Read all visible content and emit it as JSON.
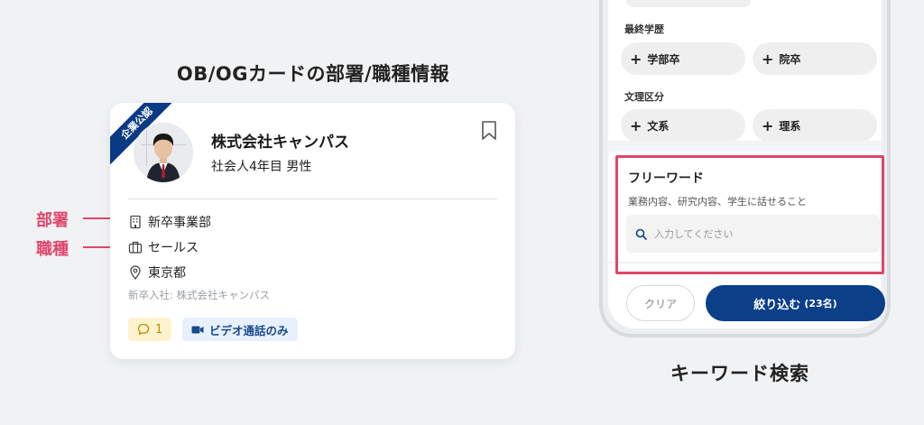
{
  "left": {
    "title": "OB/OGカードの部署/職種情報",
    "ribbon": "企業公認",
    "company": "株式会社キャンパス",
    "sub": "社会人4年目 男性",
    "department": "新卒事業部",
    "job": "セールス",
    "location": "東京都",
    "hire_info": "新卒入社: 株式会社キャンパス",
    "comment_count": "1",
    "video_badge": "ビデオ通話のみ",
    "annotations": {
      "department": "部署",
      "job": "職種"
    }
  },
  "right": {
    "title": "キーワード検索",
    "education_label": "最終学歴",
    "education_chips": [
      "学部卒",
      "院卒"
    ],
    "field_label": "文理区分",
    "field_chips": [
      "文系",
      "理系"
    ],
    "free_word": {
      "title": "フリーワード",
      "subtitle": "業務内容、研究内容、学生に話せること",
      "placeholder": "入力してください"
    },
    "clear_label": "クリア",
    "apply_label": "絞り込む",
    "apply_count": "(23名)"
  },
  "colors": {
    "accent": "#e0466a",
    "brand": "#0b3f88"
  }
}
